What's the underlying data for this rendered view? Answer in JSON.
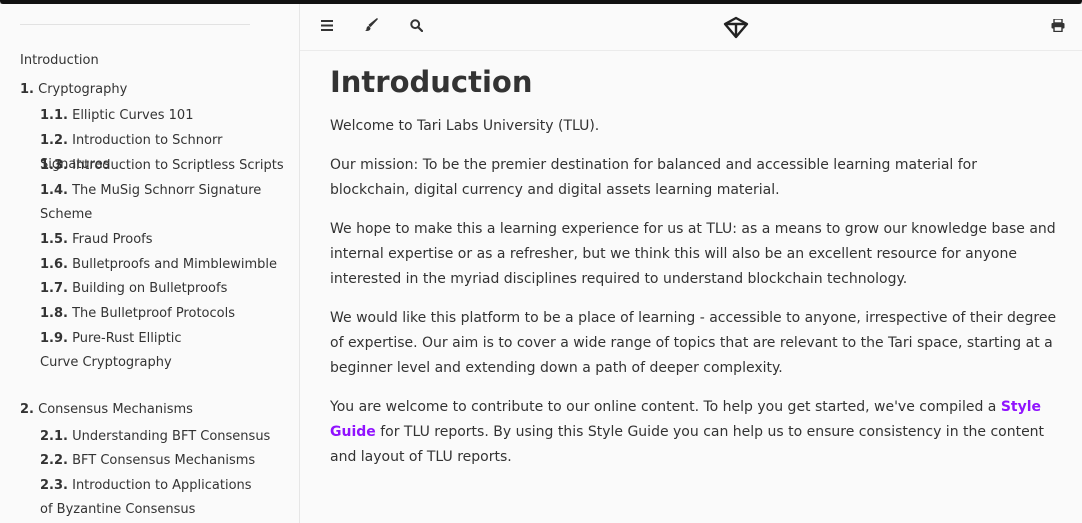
{
  "sidebar": {
    "intro_label": "Introduction",
    "chapters": [
      {
        "num": "1.",
        "label": "Cryptography",
        "sections": [
          {
            "num": "1.1.",
            "label": "Elliptic Curves 101"
          },
          {
            "num": "1.2.",
            "label": "Introduction to Schnorr Signatures"
          },
          {
            "num": "1.3.",
            "label": "Introduction to Scriptless Scripts"
          },
          {
            "num": "1.4.",
            "label": "The MuSig Schnorr Signature Scheme"
          },
          {
            "num": "1.5.",
            "label": "Fraud Proofs"
          },
          {
            "num": "1.6.",
            "label": "Bulletproofs and Mimblewimble"
          },
          {
            "num": "1.7.",
            "label": "Building on Bulletproofs"
          },
          {
            "num": "1.8.",
            "label": "The Bulletproof Protocols"
          },
          {
            "num": "1.9.",
            "label": "Pure-Rust Elliptic Curve Cryptography"
          }
        ]
      },
      {
        "num": "2.",
        "label": "Consensus Mechanisms",
        "sections": [
          {
            "num": "2.1.",
            "label": "Understanding BFT Consensus"
          },
          {
            "num": "2.2.",
            "label": "BFT Consensus Mechanisms"
          },
          {
            "num": "2.3.",
            "label": "Introduction to Applications of Byzantine Consensus Mechanisms"
          }
        ]
      }
    ]
  },
  "toolbar": {
    "icons": {
      "menu": "bars-icon",
      "theme": "paintbrush-icon",
      "search": "search-icon",
      "logo": "tari-logo-icon",
      "print": "print-icon"
    }
  },
  "main": {
    "title": "Introduction",
    "p1": "Welcome to Tari Labs University (TLU).",
    "p2": "Our mission: To be the premier destination for balanced and accessible learning material for blockchain, digital currency and digital assets learning material.",
    "p3": "We hope to make this a learning experience for us at TLU: as a means to grow our knowledge base and internal expertise or as a refresher, but we think this will also be an excellent resource for anyone interested in the myriad disciplines required to understand blockchain technology.",
    "p4": "We would like this platform to be a place of learning - accessible to anyone, irrespective of their degree of expertise. Our aim is to cover a wide range of topics that are relevant to the Tari space, starting at a beginner level and extending down a path of deeper complexity.",
    "p5_before": "You are welcome to contribute to our online content. To help you get started, we've compiled a ",
    "p5_link": "Style Guide",
    "p5_after": " for TLU reports. By using this Style Guide you can help us to ensure consistency in the content and layout of TLU reports.",
    "link_color": "#9013fe"
  }
}
